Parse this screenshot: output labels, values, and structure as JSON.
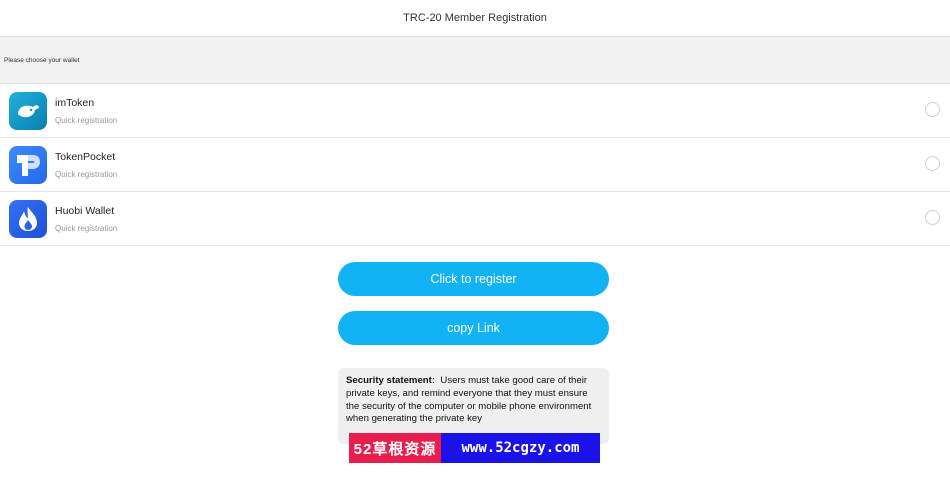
{
  "header": {
    "title": "TRC-20 Member Registration"
  },
  "section": {
    "prompt": "Please choose your wallet"
  },
  "wallets": [
    {
      "name": "imToken",
      "subtitle": "Quick registration",
      "icon": "imtoken-logo-icon",
      "color": "#0f8fc0"
    },
    {
      "name": "TokenPocket",
      "subtitle": "Quick registration",
      "icon": "tokenpocket-logo-icon",
      "color": "#2f7cf6"
    },
    {
      "name": "Huobi Wallet",
      "subtitle": "Quick registration",
      "icon": "huobi-logo-icon",
      "color": "#2a62e8"
    }
  ],
  "actions": {
    "register_label": "Click to register",
    "copy_label": "copy Link",
    "accent": "#12b3f5"
  },
  "security": {
    "title": "Security statement:",
    "text": "Users must take good care of their private keys, and remind everyone that they must ensure the security of the computer or mobile phone environment when generating the private key"
  },
  "watermark": {
    "left_text": "52草根资源",
    "right_text": "www.52cgzy.com"
  }
}
